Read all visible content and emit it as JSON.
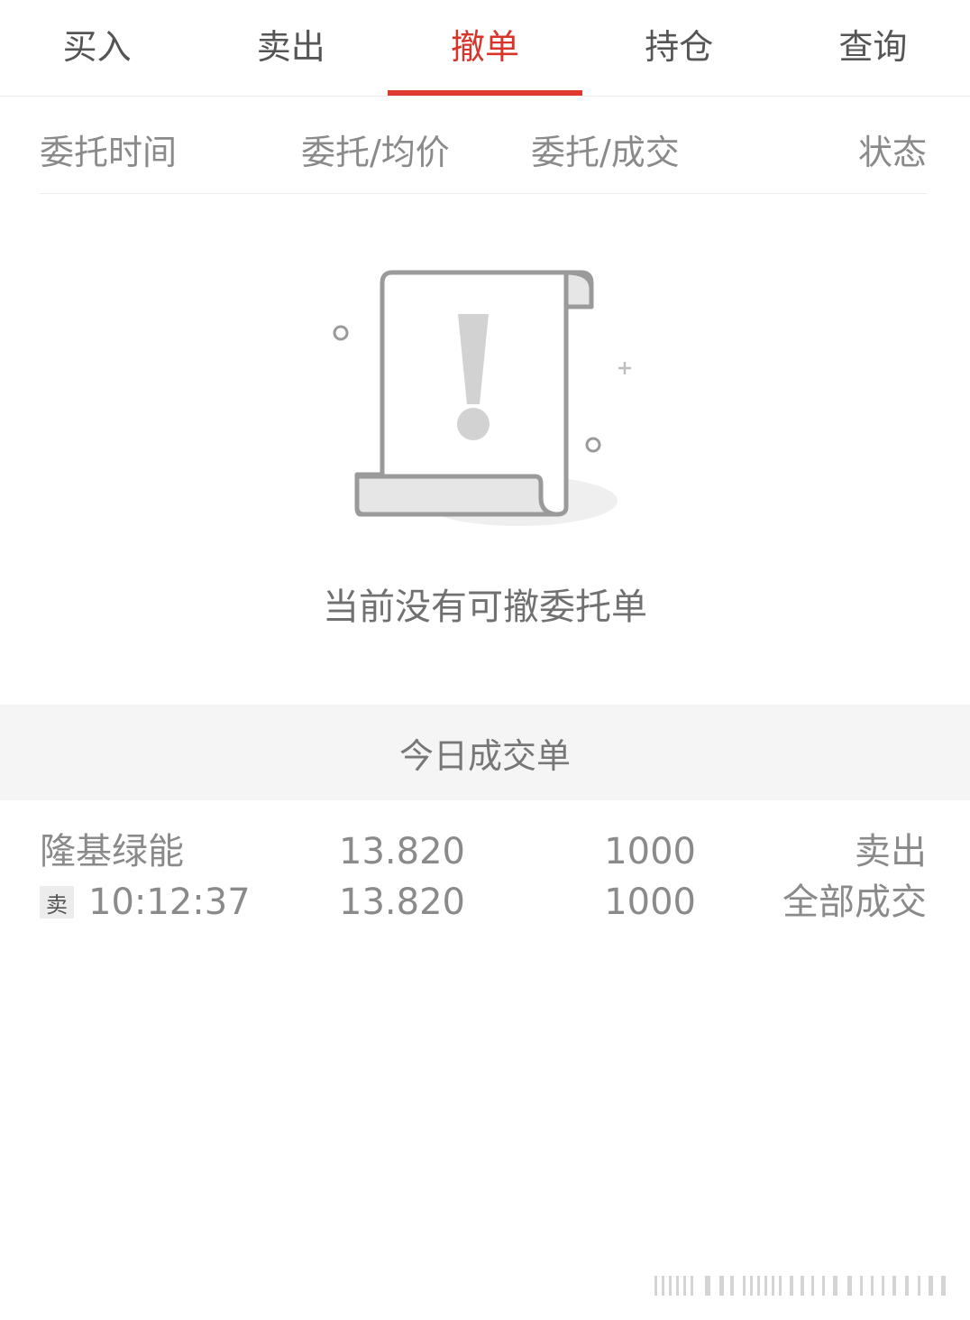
{
  "tabs": [
    {
      "label": "买入",
      "active": false
    },
    {
      "label": "卖出",
      "active": false
    },
    {
      "label": "撤单",
      "active": true
    },
    {
      "label": "持仓",
      "active": false
    },
    {
      "label": "查询",
      "active": false
    }
  ],
  "columns": {
    "time": "委托时间",
    "price": "委托/均价",
    "qty": "委托/成交",
    "status": "状态"
  },
  "empty_state": {
    "icon": "warning-document-icon",
    "message": "当前没有可撤委托单"
  },
  "today": {
    "title": "今日成交单",
    "rows": [
      {
        "name": "隆基绿能",
        "side_badge": "卖",
        "time": "10:12:37",
        "order_price": "13.820",
        "avg_price": "13.820",
        "order_qty": "1000",
        "filled_qty": "1000",
        "direction": "卖出",
        "status": "全部成交"
      }
    ]
  },
  "colors": {
    "accent": "#e03a30",
    "text": "#8a8a8a",
    "bar_bg": "#f5f5f5"
  }
}
